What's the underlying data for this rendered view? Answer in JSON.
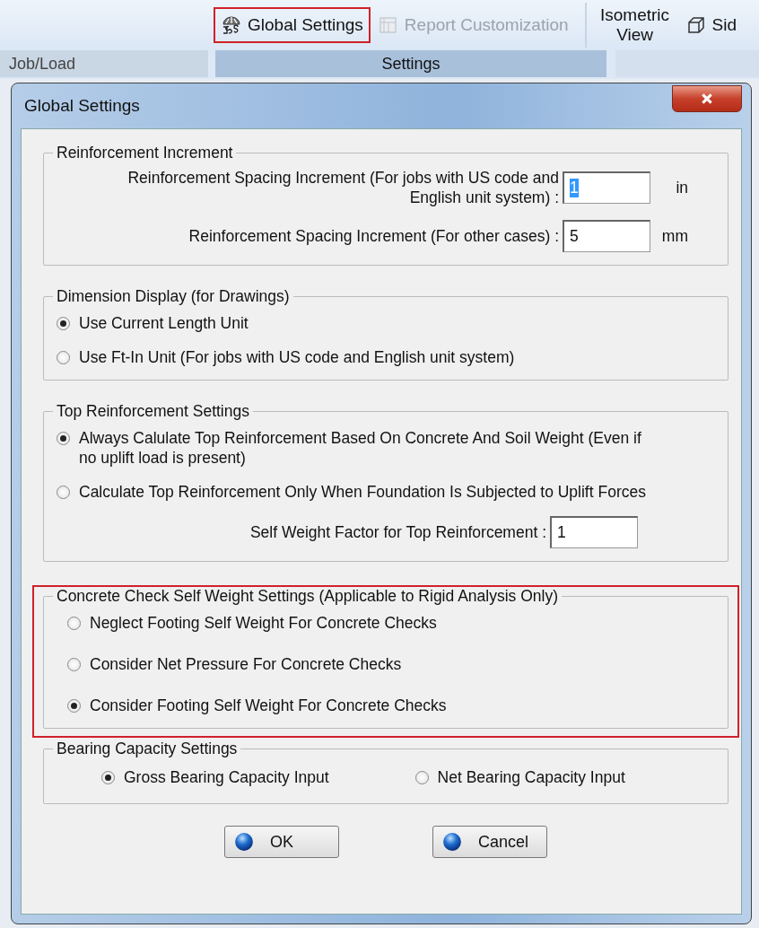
{
  "ribbon": {
    "items": [
      {
        "label": "Global Settings",
        "kind": "gs",
        "disabled": false,
        "highlighted": true
      },
      {
        "label": "Report Customization",
        "kind": "report",
        "disabled": true,
        "highlighted": false
      },
      {
        "label": "Isometric View",
        "kind": "text",
        "disabled": false,
        "highlighted": false
      },
      {
        "label": "Sid",
        "kind": "cube",
        "disabled": false,
        "highlighted": false
      }
    ],
    "group_labels": [
      {
        "label": "Job/Load",
        "selected": false
      },
      {
        "label": "Settings",
        "selected": true
      }
    ]
  },
  "dialog": {
    "title": "Global Settings",
    "groups": [
      {
        "kind": "fields",
        "title": "Reinforcement Increment",
        "highlighted": false,
        "fields": [
          {
            "label": "Reinforcement Spacing Increment (For jobs with US code and\nEnglish unit system) :",
            "value": "1",
            "unit": "in",
            "text_selected": true
          },
          {
            "label": "Reinforcement Spacing Increment (For other cases) :",
            "value": "5",
            "unit": "mm",
            "text_selected": false
          }
        ]
      },
      {
        "kind": "radios",
        "title": "Dimension Display (for Drawings)",
        "highlighted": false,
        "options": [
          {
            "label": "Use Current Length Unit",
            "selected": true
          },
          {
            "label": "Use Ft-In Unit (For jobs with US code and English unit system)",
            "selected": false
          }
        ]
      },
      {
        "kind": "radios",
        "title": "Top Reinforcement Settings",
        "highlighted": false,
        "options": [
          {
            "label": "Always Calulate Top Reinforcement Based On Concrete And Soil Weight (Even if\nno uplift load is present)",
            "selected": true
          },
          {
            "label": "Calculate Top Reinforcement Only When Foundation Is Subjected to Uplift Forces",
            "selected": false
          }
        ],
        "fields": [
          {
            "label": "Self Weight Factor for Top Reinforcement  :",
            "value": "1",
            "text_selected": false
          }
        ]
      },
      {
        "kind": "radios",
        "title": "Concrete Check Self Weight Settings (Applicable to Rigid Analysis Only)",
        "highlighted": true,
        "options": [
          {
            "label": "Neglect Footing Self Weight For Concrete Checks",
            "selected": false
          },
          {
            "label": "Consider Net Pressure For Concrete Checks",
            "selected": false
          },
          {
            "label": "Consider Footing Self Weight For Concrete Checks",
            "selected": true
          }
        ]
      },
      {
        "kind": "radio-row",
        "title": "Bearing Capacity Settings",
        "highlighted": false,
        "options": [
          {
            "label": "Gross Bearing Capacity Input",
            "selected": true
          },
          {
            "label": "Net Bearing Capacity Input",
            "selected": false
          }
        ]
      }
    ],
    "buttons": [
      {
        "label": "OK"
      },
      {
        "label": "Cancel"
      }
    ]
  }
}
